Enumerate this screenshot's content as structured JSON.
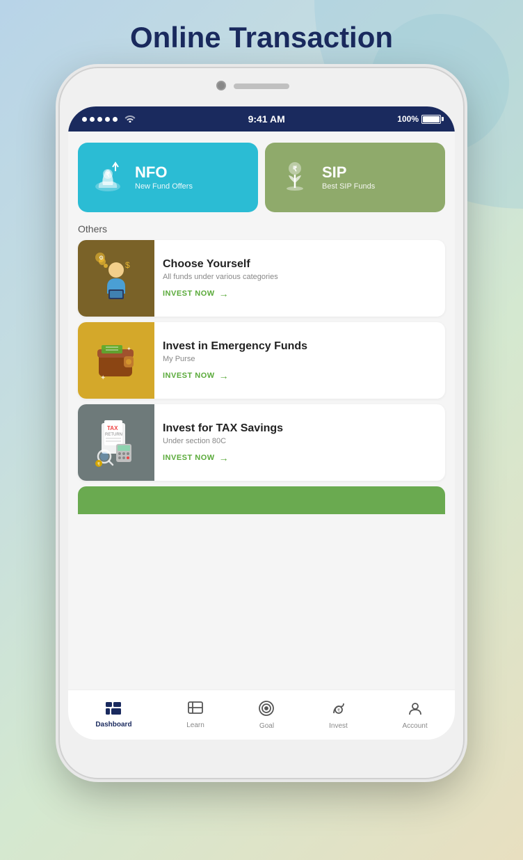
{
  "page": {
    "title": "Online Transaction"
  },
  "status_bar": {
    "time": "9:41 AM",
    "battery": "100%"
  },
  "top_cards": [
    {
      "id": "nfo",
      "label": "NFO",
      "sublabel": "New Fund Offers",
      "color": "#2bbcd4"
    },
    {
      "id": "sip",
      "label": "SIP",
      "sublabel": "Best SIP Funds",
      "color": "#8faa6b"
    }
  ],
  "others_label": "Others",
  "invest_items": [
    {
      "id": "choose-yourself",
      "title": "Choose Yourself",
      "subtitle": "All funds under various categories",
      "cta": "INVEST NOW",
      "thumb_bg": "#7a6228"
    },
    {
      "id": "emergency-funds",
      "title": "Invest in Emergency Funds",
      "subtitle": "My Purse",
      "cta": "INVEST NOW",
      "thumb_bg": "#d4a82a"
    },
    {
      "id": "tax-savings",
      "title": "Invest for TAX Savings",
      "subtitle": "Under section 80C",
      "cta": "INVEST NOW",
      "thumb_bg": "#6e7a7a"
    }
  ],
  "bottom_nav": [
    {
      "id": "dashboard",
      "label": "Dashboard",
      "active": true
    },
    {
      "id": "learn",
      "label": "Learn",
      "active": false
    },
    {
      "id": "goal",
      "label": "Goal",
      "active": false
    },
    {
      "id": "invest",
      "label": "Invest",
      "active": false
    },
    {
      "id": "account",
      "label": "Account",
      "active": false
    }
  ]
}
